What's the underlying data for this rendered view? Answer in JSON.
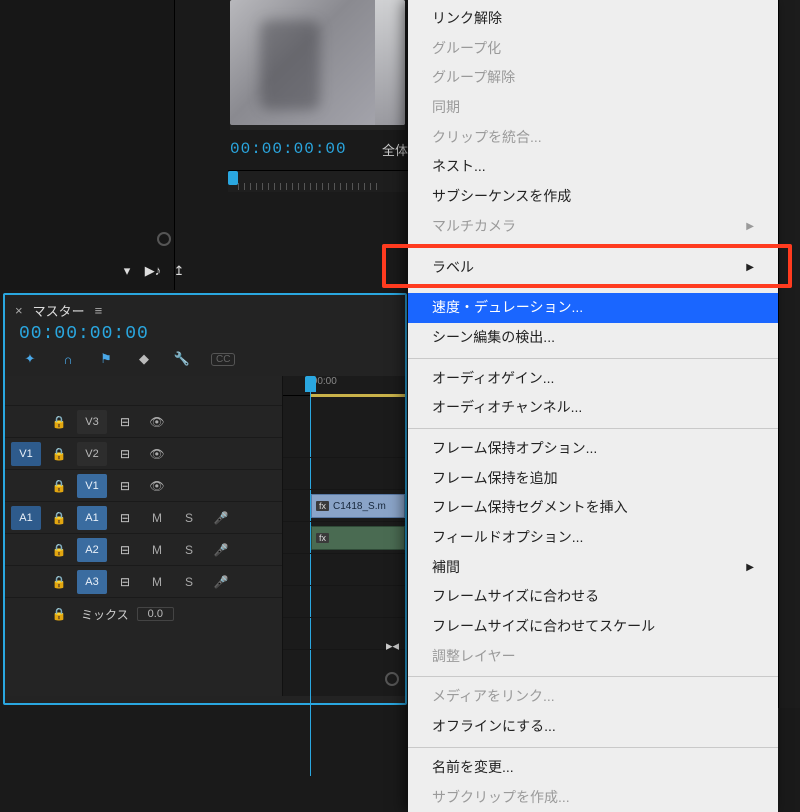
{
  "monitor": {
    "timecode": "00:00:00:00",
    "fit_label": "全体"
  },
  "top_toolbar": {
    "filter_icon": "filter",
    "play_icon": "play-music",
    "export_icon": "export"
  },
  "timeline": {
    "tab_label": "マスター",
    "timecode": "00:00:00:00",
    "ruler_label": ":00:00",
    "tools": {
      "snap": "snap",
      "magnet": "magnet",
      "linked": "linked-selection",
      "marker": "marker",
      "wrench": "settings",
      "cc": "CC"
    },
    "video_tracks": [
      {
        "src": "",
        "lock": "lock",
        "name": "V3",
        "toggle": "toggle",
        "eye": "eye"
      },
      {
        "src": "V1",
        "lock": "lock",
        "name": "V2",
        "toggle": "toggle",
        "eye": "eye"
      },
      {
        "src": "",
        "lock": "lock",
        "name": "V1",
        "toggle": "toggle",
        "eye": "eye",
        "target": true
      }
    ],
    "audio_tracks": [
      {
        "src": "A1",
        "lock": "lock",
        "name": "A1",
        "toggle": "toggle",
        "m": "M",
        "s": "S",
        "mic": "mic",
        "target": true
      },
      {
        "src": "",
        "lock": "lock",
        "name": "A2",
        "toggle": "toggle",
        "m": "M",
        "s": "S",
        "mic": "mic",
        "target": true
      },
      {
        "src": "",
        "lock": "lock",
        "name": "A3",
        "toggle": "toggle",
        "m": "M",
        "s": "S",
        "mic": "mic",
        "target": true
      }
    ],
    "mix_label": "ミックス",
    "mix_value": "0.0",
    "clip_video_label": "C1418_S.m",
    "fx_label": "fx"
  },
  "context_menu": {
    "items": [
      {
        "label": "リンク解除",
        "disabled": false
      },
      {
        "label": "グループ化",
        "disabled": true
      },
      {
        "label": "グループ解除",
        "disabled": true
      },
      {
        "label": "同期",
        "disabled": true
      },
      {
        "label": "クリップを統合...",
        "disabled": true
      },
      {
        "label": "ネスト...",
        "disabled": false
      },
      {
        "label": "サブシーケンスを作成",
        "disabled": false
      },
      {
        "label": "マルチカメラ",
        "disabled": true,
        "submenu": true
      },
      {
        "sep": true
      },
      {
        "label": "ラベル",
        "disabled": false,
        "submenu": true
      },
      {
        "sep": true
      },
      {
        "label": "速度・デュレーション...",
        "disabled": false,
        "highlight": true
      },
      {
        "label": "シーン編集の検出...",
        "disabled": false
      },
      {
        "sep": true
      },
      {
        "label": "オーディオゲイン...",
        "disabled": false
      },
      {
        "label": "オーディオチャンネル...",
        "disabled": false
      },
      {
        "sep": true
      },
      {
        "label": "フレーム保持オプション...",
        "disabled": false
      },
      {
        "label": "フレーム保持を追加",
        "disabled": false
      },
      {
        "label": "フレーム保持セグメントを挿入",
        "disabled": false
      },
      {
        "label": "フィールドオプション...",
        "disabled": false
      },
      {
        "label": "補間",
        "disabled": false,
        "submenu": true
      },
      {
        "label": "フレームサイズに合わせる",
        "disabled": false
      },
      {
        "label": "フレームサイズに合わせてスケール",
        "disabled": false
      },
      {
        "label": "調整レイヤー",
        "disabled": true
      },
      {
        "sep": true
      },
      {
        "label": "メディアをリンク...",
        "disabled": true
      },
      {
        "label": "オフラインにする...",
        "disabled": false
      },
      {
        "sep": true
      },
      {
        "label": "名前を変更...",
        "disabled": false
      },
      {
        "label": "サブクリップを作成...",
        "disabled": true
      }
    ]
  }
}
